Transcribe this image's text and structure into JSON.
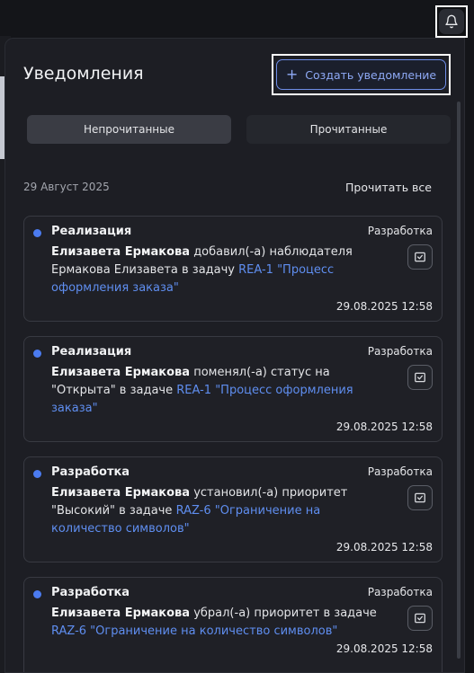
{
  "panel": {
    "title": "Уведомления",
    "create_button": {
      "plus": "+",
      "label": "Создать уведомление"
    },
    "tabs": [
      {
        "label": "Непрочитанные",
        "active": true
      },
      {
        "label": "Прочитанные",
        "active": false
      }
    ],
    "date_group": "29 Август 2025",
    "read_all": "Прочитать все"
  },
  "notifications": [
    {
      "title": "Реализация",
      "badge": "Разработка",
      "author": "Елизавета Ермакова",
      "text": " добавил(-а) наблюдателя Ермакова Елизавета в задачу ",
      "link": "REA-1 \"Процесс оформления заказа\"",
      "time": "29.08.2025 12:58"
    },
    {
      "title": "Реализация",
      "badge": "Разработка",
      "author": "Елизавета Ермакова",
      "text": " поменял(-а) статус на \"Открыта\" в задаче ",
      "link": "REA-1 \"Процесс оформления заказа\"",
      "time": "29.08.2025 12:58"
    },
    {
      "title": "Разработка",
      "badge": "Разработка",
      "author": "Елизавета Ермакова",
      "text": " установил(-а) приоритет \"Высокий\" в задаче ",
      "link": "RAZ-6 \"Ограничение на количество символов\"",
      "time": "29.08.2025 12:58"
    },
    {
      "title": "Разработка",
      "badge": "Разработка",
      "author": "Елизавета Ермакова",
      "text": " убрал(-а) приоритет в задаче ",
      "link": "RAZ-6 \"Ограничение на количество символов\"",
      "time": "29.08.2025 12:58"
    }
  ],
  "icons": {
    "bell": "bell-icon",
    "mark_read": "check-square-icon"
  },
  "colors": {
    "accent": "#5f8ef0",
    "unread_dot": "#4b7bf0",
    "panel_bg": "#1d1e24"
  }
}
